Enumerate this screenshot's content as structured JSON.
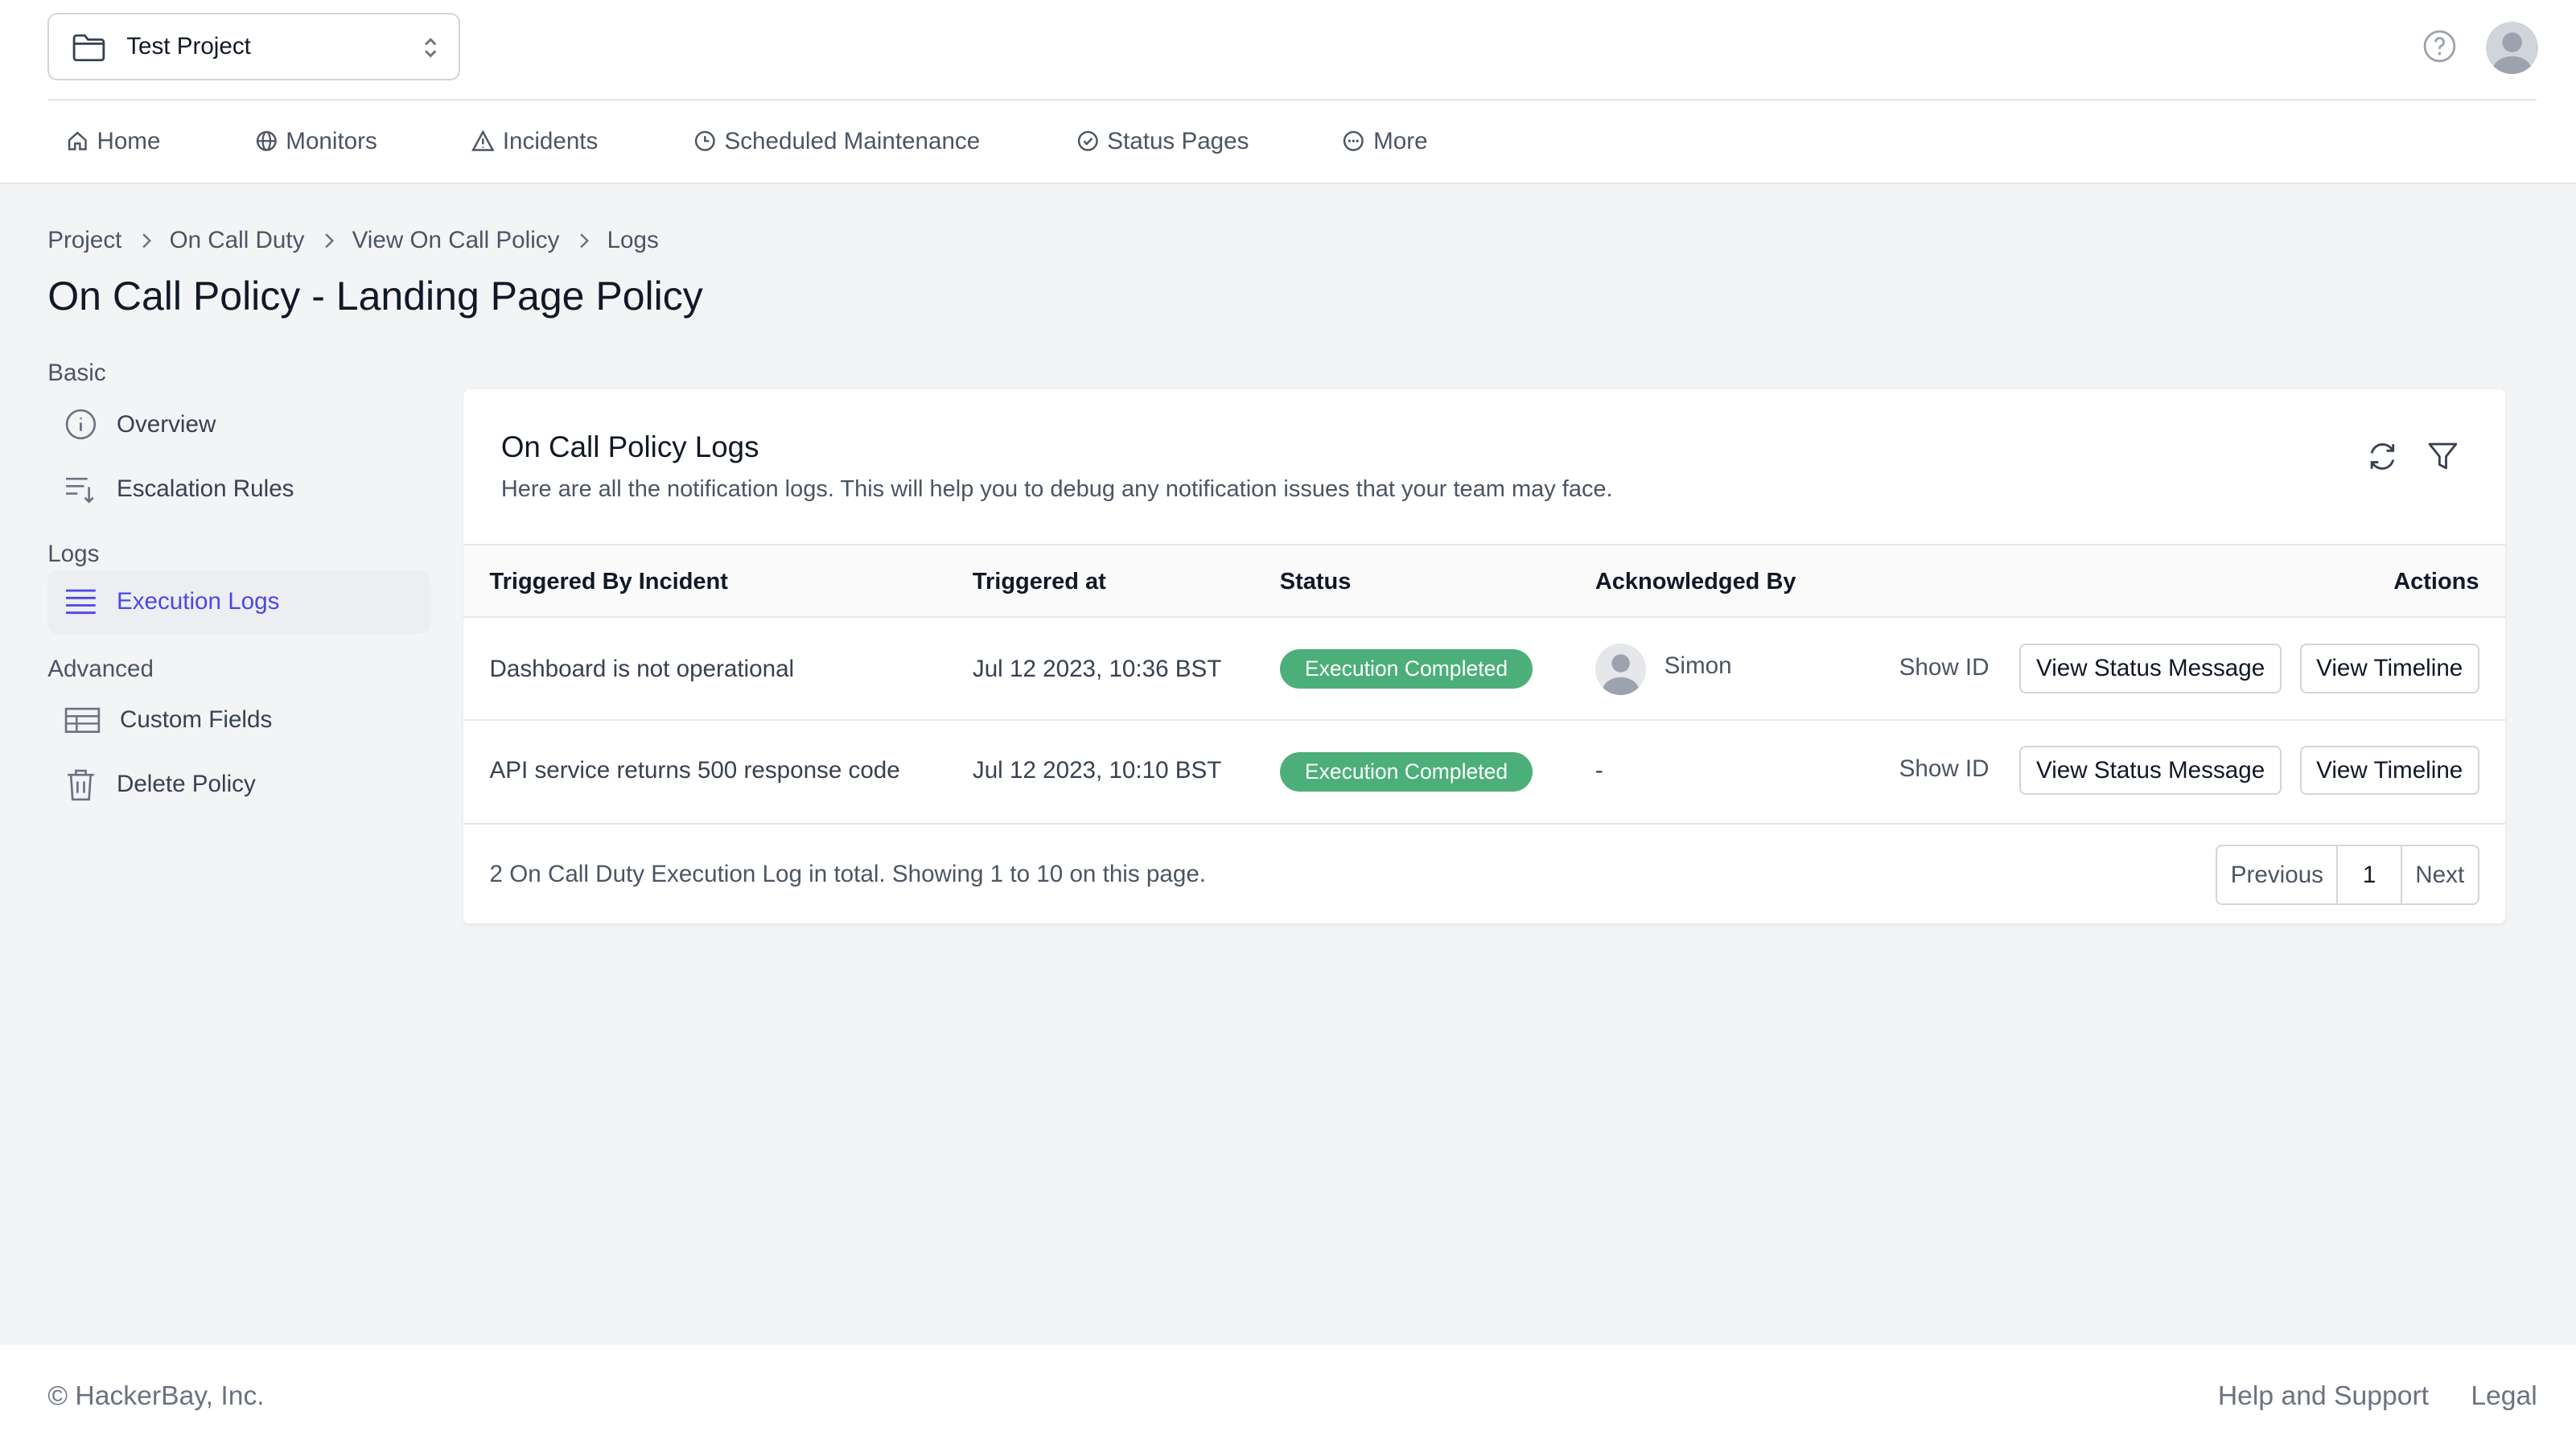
{
  "header": {
    "project_name": "Test Project",
    "nav": [
      {
        "label": "Home",
        "icon": "home-icon"
      },
      {
        "label": "Monitors",
        "icon": "globe-icon"
      },
      {
        "label": "Incidents",
        "icon": "alert-triangle-icon"
      },
      {
        "label": "Scheduled Maintenance",
        "icon": "clock-icon"
      },
      {
        "label": "Status Pages",
        "icon": "check-circle-icon"
      },
      {
        "label": "More",
        "icon": "more-circle-icon"
      }
    ]
  },
  "breadcrumb": [
    "Project",
    "On Call Duty",
    "View On Call Policy",
    "Logs"
  ],
  "page_title": "On Call Policy - Landing Page Policy",
  "sidebar": {
    "sections": [
      {
        "heading": "Basic",
        "items": [
          {
            "label": "Overview",
            "icon": "info-icon"
          },
          {
            "label": "Escalation Rules",
            "icon": "sort-lines-icon"
          }
        ]
      },
      {
        "heading": "Logs",
        "items": [
          {
            "label": "Execution Logs",
            "icon": "list-icon",
            "active": true
          }
        ]
      },
      {
        "heading": "Advanced",
        "items": [
          {
            "label": "Custom Fields",
            "icon": "table-icon"
          },
          {
            "label": "Delete Policy",
            "icon": "trash-icon"
          }
        ]
      }
    ]
  },
  "card": {
    "title": "On Call Policy Logs",
    "description": "Here are all the notification logs. This will help you to debug any notification issues that your team may face.",
    "columns": [
      "Triggered By Incident",
      "Triggered at",
      "Status",
      "Acknowledged By",
      "Actions"
    ],
    "rows": [
      {
        "incident": "Dashboard is not operational",
        "triggered_at": "Jul 12 2023, 10:36 BST",
        "status": "Execution Completed",
        "acknowledged_by": "Simon",
        "show_id": "Show ID",
        "view_status": "View Status Message",
        "view_timeline": "View Timeline"
      },
      {
        "incident": "API service returns 500 response code",
        "triggered_at": "Jul 12 2023, 10:10 BST",
        "status": "Execution Completed",
        "acknowledged_by": "-",
        "show_id": "Show ID",
        "view_status": "View Status Message",
        "view_timeline": "View Timeline"
      }
    ],
    "summary": "2 On Call Duty Execution Log in total. Showing 1 to 10 on this page.",
    "pagination": {
      "previous": "Previous",
      "current": "1",
      "next": "Next"
    }
  },
  "footer": {
    "copyright": "© HackerBay, Inc.",
    "help": "Help and Support",
    "legal": "Legal"
  },
  "colors": {
    "accent": "#4f46e5",
    "status_green": "#4caf7a",
    "background": "#f3f4f6"
  }
}
